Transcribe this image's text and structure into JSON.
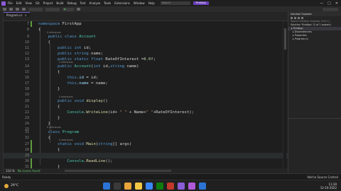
{
  "titlebar": {
    "menu": [
      "File",
      "Edit",
      "View",
      "Git",
      "Project",
      "Build",
      "Debug",
      "Test",
      "Analyze",
      "Tools",
      "Extensions",
      "Window",
      "Help"
    ],
    "search": "Search",
    "project": "FirstApp",
    "window_buttons": [
      "—",
      "□",
      "✕"
    ]
  },
  "tab": {
    "label": "Program.cs",
    "close": "✕"
  },
  "editor": {
    "lines": [
      {
        "n": "7",
        "code": "namespace FirstApp"
      },
      {
        "n": "8",
        "code": "{"
      },
      {
        "n": "9",
        "code": "    public class Account"
      },
      {
        "n": "10",
        "code": "    {"
      },
      {
        "n": "11",
        "code": "        public int id;"
      },
      {
        "n": "12",
        "code": "        public string name;"
      },
      {
        "n": "13",
        "code": "        public static float RateOfInterest =8.0f;"
      },
      {
        "n": "14",
        "code": "        public Account(int id,string name)"
      },
      {
        "n": "15",
        "code": "        {"
      },
      {
        "n": "16",
        "code": "            this.id = id;"
      },
      {
        "n": "17",
        "code": "            this.name = name;"
      },
      {
        "n": "18",
        "code": "        }"
      },
      {
        "n": "19",
        "code": ""
      },
      {
        "n": "20",
        "code": "        public void display()"
      },
      {
        "n": "21",
        "code": "        {"
      },
      {
        "n": "22",
        "code": "            Console.WriteLine(id+ \" \" + Name+\" \"+RateOfInterest);"
      },
      {
        "n": "23",
        "code": "        }"
      },
      {
        "n": "24",
        "code": "    }"
      },
      {
        "n": "25",
        "code": ""
      },
      {
        "n": "26",
        "code": ""
      },
      {
        "n": "31",
        "code": "    class Program"
      },
      {
        "n": "32",
        "code": "    {"
      },
      {
        "n": "27",
        "code": "        static void Main(string[] args)"
      },
      {
        "n": "28",
        "code": "        {"
      },
      {
        "n": "29",
        "code": ""
      },
      {
        "n": "30",
        "code": "            Console.ReadLine();"
      },
      {
        "n": "31",
        "code": "        }"
      }
    ],
    "references": [
      "0 references",
      "0 references",
      "0 references",
      "0 references",
      "0 references"
    ]
  },
  "bottom_bar": {
    "zoom": "110 %",
    "issues": "No issues found"
  },
  "statusbar": {
    "left": "Ready",
    "right": "Add to Source Control"
  },
  "solution_explorer": {
    "title": "Solution Explorer",
    "items": [
      "Search Solution Explorer (Ctrl+;)",
      "Solution 'FirstApp' (1 of 1 project)",
      "▸ FirstApp",
      "  ▸ Dependencies",
      "  ▸ Properties",
      "  ▸ Program.cs"
    ]
  },
  "taskbar": {
    "weather": "29°C",
    "clock_time": "11:30",
    "clock_date": "12-10-2022",
    "app_colors": [
      "#2b74d6",
      "#3a3a3a",
      "#e8a33a",
      "#f2c744",
      "#3a86ff",
      "#0f7b0f",
      "#c0392b",
      "#8a5cd6",
      "#b05ad9",
      "#2b74d6"
    ]
  }
}
